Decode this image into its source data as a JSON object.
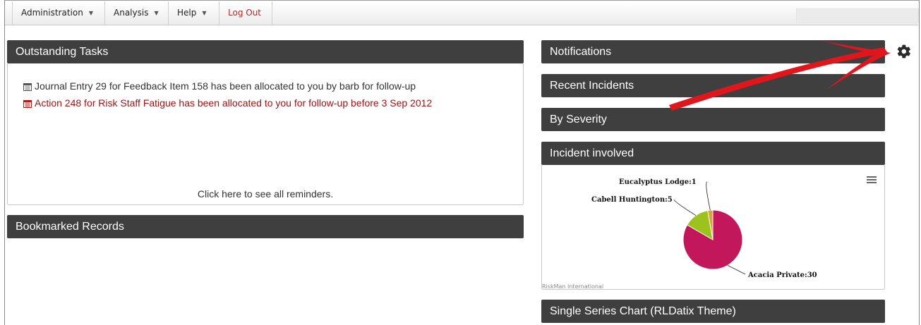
{
  "menu": {
    "items": [
      {
        "label": "Administration",
        "has_caret": true
      },
      {
        "label": "Analysis",
        "has_caret": true
      },
      {
        "label": "Help",
        "has_caret": true
      },
      {
        "label": "Log Out",
        "has_caret": false
      }
    ]
  },
  "left": {
    "outstanding_tasks": {
      "title": "Outstanding Tasks",
      "tasks": [
        {
          "icon": "calendar-icon",
          "text": "Journal Entry 29 for Feedback Item 158 has been allocated to you by barb for follow-up",
          "color": "#333333"
        },
        {
          "icon": "calendar-icon",
          "text": "Action 248 for Risk Staff Fatigue has been allocated to you for follow-up before 3 Sep 2012",
          "color": "#9a1414"
        }
      ],
      "footer_link": "Click here to see all reminders."
    },
    "bookmarked_records": {
      "title": "Bookmarked Records"
    }
  },
  "right": {
    "notifications": {
      "title": "Notifications"
    },
    "recent_incidents": {
      "title": "Recent Incidents"
    },
    "by_severity": {
      "title": "By Severity"
    },
    "incident_involved": {
      "title": "Incident involved",
      "credit": "RiskMan International"
    },
    "single_series": {
      "title": "Single Series Chart (RLDatix Theme)"
    }
  },
  "icons": {
    "settings": "gear-icon",
    "chart_menu": "hamburger-menu-icon",
    "annotation": "red-arrow"
  },
  "colors": {
    "header_bg": "#3f3f3f",
    "logout": "#d11a1a",
    "arrow": "#e0161c"
  },
  "chart_data": {
    "type": "pie",
    "title": "",
    "categories": [
      "Acacia Private",
      "Cabell Huntington",
      "Eucalyptus Lodge"
    ],
    "values": [
      30,
      5,
      1
    ],
    "colors": [
      "#c2185b",
      "#9cc21e",
      "#d7a43a"
    ],
    "data_labels": [
      "Acacia Private:30",
      "Cabell Huntington:5",
      "Eucalyptus Lodge:1"
    ]
  }
}
